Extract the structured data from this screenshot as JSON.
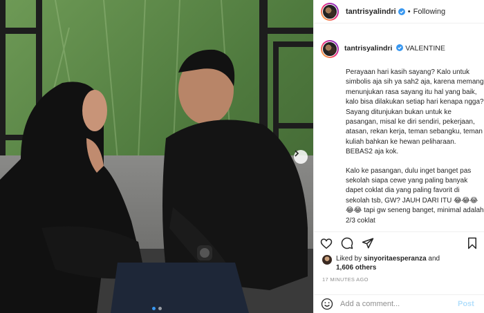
{
  "post": {
    "username": "tantrisyalindri",
    "follow_state": "Following",
    "separator": "•",
    "caption_title": "VALENTINE",
    "caption_paragraphs": [
      "Perayaan hari kasih sayang? Kalo untuk simbolis aja sih ya sah2 aja, karena memang menunjukan rasa sayang itu hal yang baik, kalo bisa dilakukan setiap hari kenapa ngga? Sayang ditunjukan bukan untuk ke pasangan, misal ke diri sendiri, pekerjaan, atasan, rekan kerja, teman sebangku, teman kuliah bahkan ke hewan peliharaan. BEBAS2 aja kok.",
      "Kalo ke pasangan, dulu inget banget pas sekolah siapa cewe yang paling banyak dapet coklat dia yang paling favorit di sekolah tsb, GW? JAUH DARI ITU 😂😂😂😂😂 tapi gw seneng banget, minimal adalah 2/3 coklat"
    ],
    "likes": {
      "prefix": "Liked by",
      "user": "sinyoritaesperanza",
      "and": "and",
      "others": "1,606 others"
    },
    "timestamp": "17 MINUTES AGO",
    "comment_placeholder": "Add a comment...",
    "post_label": "Post"
  },
  "media": {
    "slide_count": 2,
    "active_slide": 1
  },
  "colors": {
    "verified": "#3897f0",
    "border": "#efefef",
    "muted": "#8e8e8e",
    "post_button": "#b2dffc"
  },
  "icons": {
    "like": "heart-icon",
    "comment": "comment-icon",
    "share": "paper-plane-icon",
    "save": "bookmark-icon",
    "emoji": "smiley-icon",
    "next": "chevron-right-icon",
    "verified": "verified-badge-icon"
  }
}
